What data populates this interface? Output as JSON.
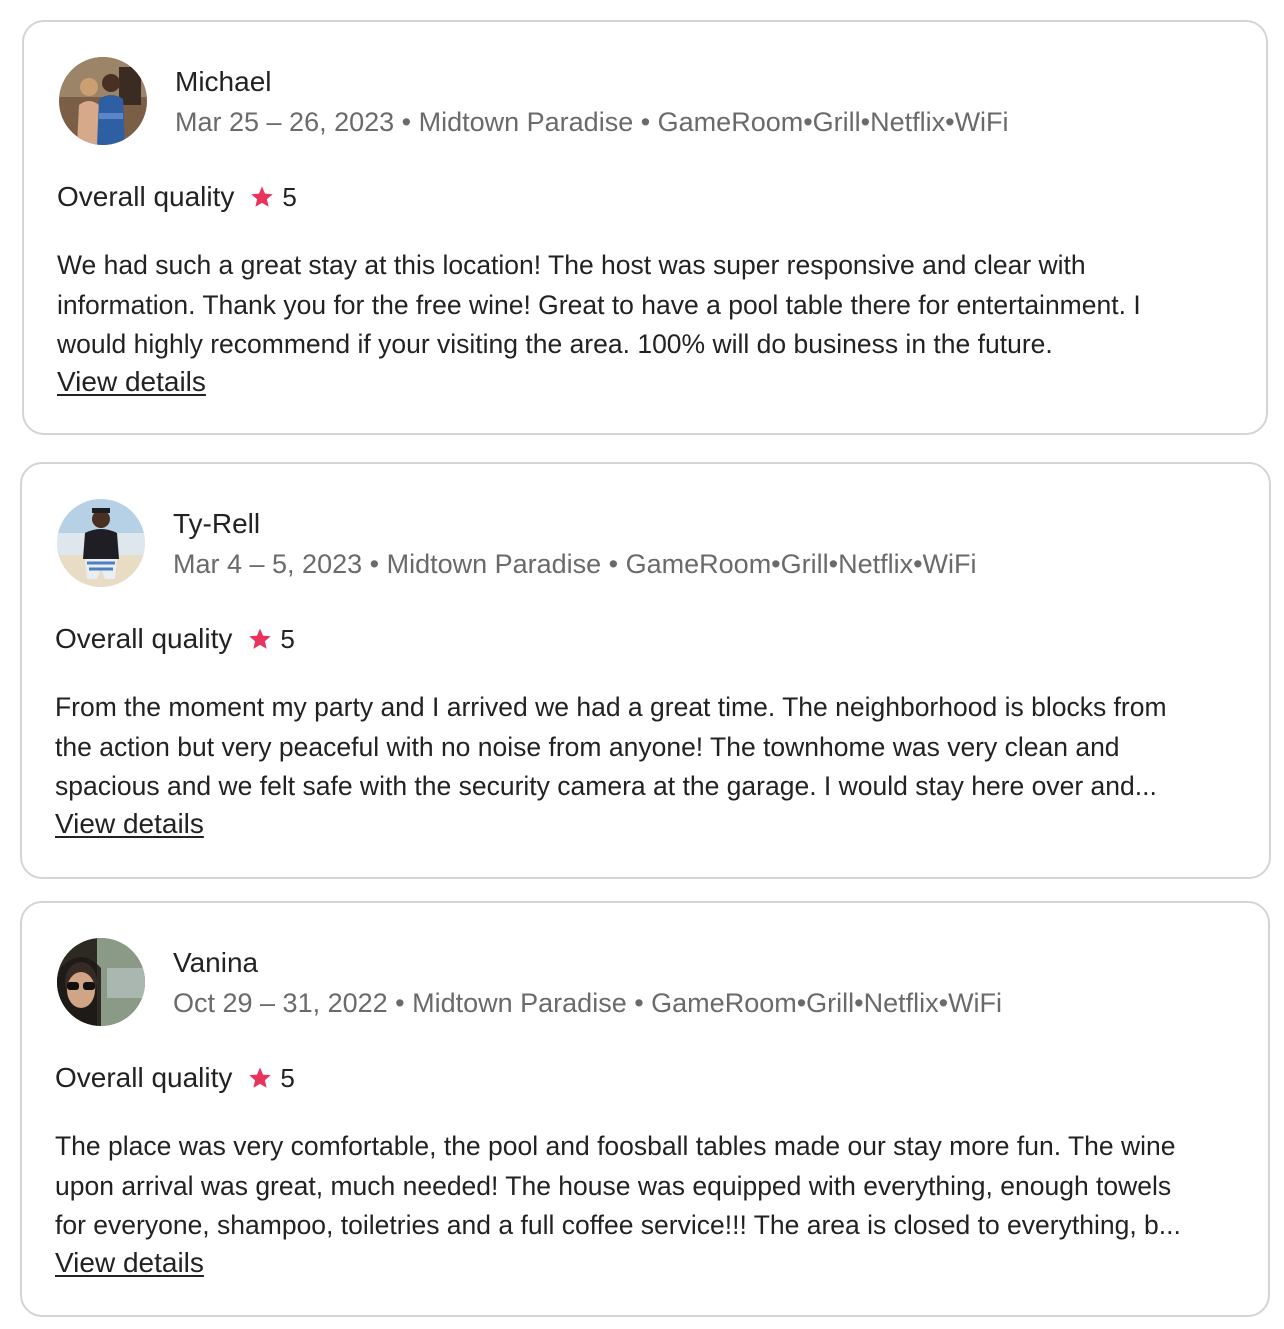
{
  "reviews": [
    {
      "reviewer": "Michael",
      "meta": "Mar 25 – 26, 2023 • Midtown Paradise • GameRoom•Grill•Netflix•WiFi",
      "rating_label": "Overall quality",
      "rating_value": "5",
      "text_lines": [
        "We had such a great stay at this location! The host was super responsive and clear with",
        "information. Thank you for the free wine! Great to have a pool table there for entertainment. I",
        "would highly recommend if your visiting the area. 100% will do business in the future."
      ],
      "link_label": "View details"
    },
    {
      "reviewer": "Ty-Rell",
      "meta": "Mar 4 – 5, 2023 • Midtown Paradise • GameRoom•Grill•Netflix•WiFi",
      "rating_label": "Overall quality",
      "rating_value": "5",
      "text_lines": [
        "From the moment my party and I arrived we had a great time. The neighborhood is blocks from",
        "the action but very peaceful with no noise from anyone! The townhome was very clean and",
        "spacious and we felt safe with the security camera at the garage. I would stay here over and..."
      ],
      "link_label": "View details"
    },
    {
      "reviewer": "Vanina",
      "meta": "Oct 29 – 31, 2022 • Midtown Paradise • GameRoom•Grill•Netflix•WiFi",
      "rating_label": "Overall quality",
      "rating_value": "5",
      "text_lines": [
        "The place was very comfortable, the pool and foosball tables made our stay more fun. The wine",
        "upon arrival was great, much needed! The house was equipped with everything, enough towels",
        "for everyone, shampoo, toiletries and a full coffee service!!! The area is closed to everything, b..."
      ],
      "link_label": "View details"
    }
  ],
  "colors": {
    "star": "#e8345c",
    "text_primary": "#222222",
    "text_secondary": "#6a6a6a",
    "card_border": "#d4d4d4"
  },
  "icons": {
    "rating": "star-icon"
  }
}
